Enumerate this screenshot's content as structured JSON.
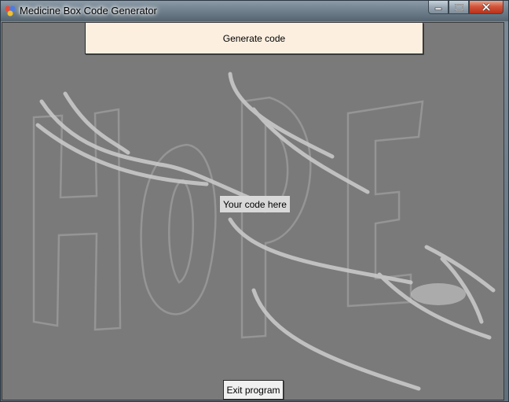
{
  "window": {
    "title": "Medicine Box Code Generator"
  },
  "icons": {
    "app": "app-icon",
    "minimize": "minimize-icon",
    "maximize": "maximize-icon",
    "close": "close-icon"
  },
  "background": {
    "artwork_text": "HOPE"
  },
  "main": {
    "generate_label": "Generate code",
    "code_label": "Your code here",
    "exit_label": "Exit program"
  },
  "colors": {
    "generate_button_bg": "#fcefe0",
    "client_bg": "#7d7d7d",
    "close_button": "#c43b22"
  }
}
